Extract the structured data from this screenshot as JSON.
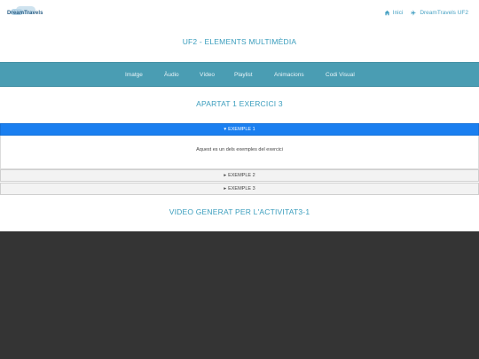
{
  "header": {
    "logo_text": "DreamTravels",
    "nav": [
      {
        "label": "Inici",
        "icon": "home-icon"
      },
      {
        "label": "DreamTravels UF2",
        "icon": "plane-icon"
      }
    ]
  },
  "page_title": "UF2 - ELEMENTS MULTIMÈDIA",
  "menu": {
    "items": [
      "Imatge",
      "Àudio",
      "Vídeo",
      "Playlist",
      "Animacions",
      "Codi Visual"
    ]
  },
  "section1": {
    "title": "APARTAT 1 EXERCICI 3",
    "accordion": [
      {
        "label": "EXEMPLE 1",
        "expanded": true,
        "body": "Aquest es un dels exemples del exercici"
      },
      {
        "label": "EXEMPLE 2",
        "expanded": false
      },
      {
        "label": "EXEMPLE 3",
        "expanded": false
      }
    ]
  },
  "section2": {
    "title": "VIDEO GENERAT PER L'ACTIVITAT3-1"
  },
  "colors": {
    "accent": "#3a9dbd",
    "menubar": "#4a9db3",
    "active_accordion": "#1a7ff0",
    "video_bg": "#343434"
  }
}
